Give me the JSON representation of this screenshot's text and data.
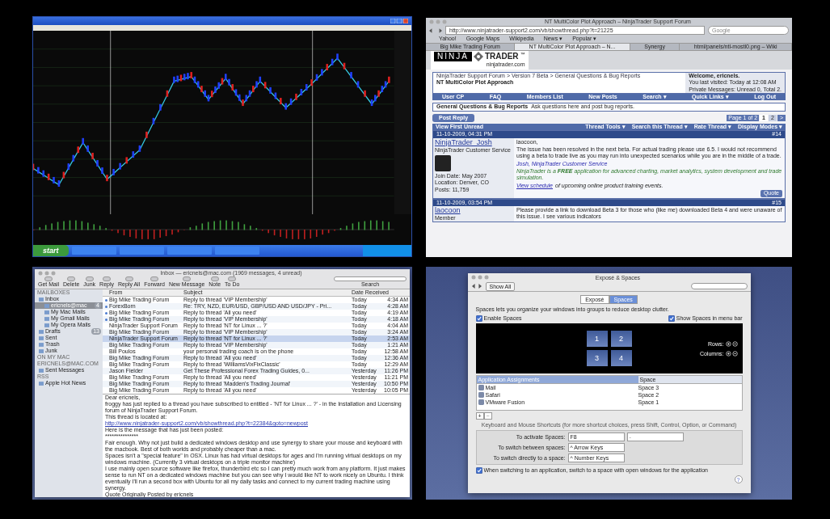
{
  "trading_space": {
    "taskbar": {
      "start": "start"
    }
  },
  "browser_space": {
    "title": "NT MultiColor Plot Approach – NinjaTrader Support Forum",
    "url": "http://www.ninjatrader-support2.com/vb/showthread.php?t=21225",
    "search_placeholder": "Google",
    "bookmarks": [
      "Yahoo!",
      "Google Maps",
      "Wikipedia",
      "News ▾",
      "Popular ▾"
    ],
    "tabs": [
      {
        "label": "Big Mike Trading Forum",
        "selected": false
      },
      {
        "label": "NT MultiColor Plot Approach – N...",
        "selected": true
      },
      {
        "label": "Synergy",
        "selected": false
      },
      {
        "label": "html/panels/ntl-mostl0.png – Wiki",
        "selected": false
      }
    ],
    "logo": {
      "left": "NINJA",
      "right": "TRADER",
      "tm": "™",
      "site": "ninjatrader.com"
    },
    "breadcrumb": "NinjaTrader Support Forum > Version 7 Beta > General Questions & Bug Reports",
    "thread_title": "NT MultiColor Plot Approach",
    "welcome": "Welcome, ericnels.",
    "last_visit": "You last visited: Today at 12:08 AM",
    "private_messages": "Private Messages: Unread 0, Total 2.",
    "nav": [
      "User CP",
      "FAQ",
      "Members List",
      "New Posts",
      "Search ▾",
      "Quick Links ▾",
      "Log Out"
    ],
    "forum_name": "General Questions & Bug Reports",
    "forum_desc": "Ask questions here and post bug reports.",
    "post_reply": "Post Reply",
    "pager": {
      "label": "Page 1 of 2",
      "pages": [
        {
          "label": "1",
          "selected": true
        },
        {
          "label": "2",
          "selected": false
        }
      ],
      "next": ">"
    },
    "first_unread": "View First Unread",
    "thread_tools": [
      "Thread Tools ▾",
      "Search this Thread ▾",
      "Rate Thread ▾",
      "Display Modes ▾"
    ],
    "posts": [
      {
        "date": "11-10-2009, 04:31 PM",
        "number": "#14",
        "author": "NinjaTrader_Josh",
        "role": "NinjaTrader Customer Service",
        "details": [
          "Join Date: May 2007",
          "Location: Denver, CO",
          "Posts: 11,759"
        ],
        "quote": "Quote",
        "body": [
          {
            "kind": "text",
            "text": "laocoon,"
          },
          {
            "kind": "text",
            "text": "The issue has been resolved in the next beta. For actual trading please use 6.5. I would not recommend using a beta to trade live as you may run into unexpected scenarios while you are in the middle of a trade."
          },
          {
            "kind": "signature",
            "text": "Josh, NinjaTrader Customer Service"
          },
          {
            "kind": "promo",
            "text": "NinjaTrader is a **FREE** application for advanced charting, market analytics, system development and trade simulation."
          },
          {
            "kind": "schedule",
            "link": "View schedule",
            "text": "of upcoming online product training events."
          }
        ]
      },
      {
        "date": "11-10-2009, 03:54 PM",
        "number": "#15",
        "author": "laocoon",
        "role": "Member",
        "body": [
          {
            "kind": "text",
            "text": "Please provide a link to download Beta 3 for those who (like me) downloaded Beta 4 and were unaware of this issue. I see various indicators"
          }
        ]
      }
    ]
  },
  "mail_space": {
    "title": "Inbox — ericnels@mac.com (1969 messages, 4 unread)",
    "toolbar": [
      "Get Mail",
      "Delete",
      "Junk",
      "Reply",
      "Reply All",
      "Forward",
      "New Message",
      "Note",
      "To Do"
    ],
    "search_label": "Search",
    "sidebar": [
      {
        "kind": "header",
        "label": "MAILBOXES"
      },
      {
        "kind": "mailbox",
        "label": "Inbox",
        "selected": false,
        "children": [
          {
            "kind": "mailbox",
            "label": "ericnels@mac",
            "selected": true,
            "badge": "4"
          },
          {
            "kind": "mailbox",
            "label": "My Mac Mails",
            "selected": false
          },
          {
            "kind": "mailbox",
            "label": "My Gmail Mails",
            "selected": false
          },
          {
            "kind": "mailbox",
            "label": "My Opera Mails",
            "selected": false
          }
        ]
      },
      {
        "kind": "mailbox",
        "label": "Drafts",
        "selected": false,
        "badge": "13"
      },
      {
        "kind": "mailbox",
        "label": "Sent",
        "selected": false
      },
      {
        "kind": "mailbox",
        "label": "Trash",
        "selected": false
      },
      {
        "kind": "mailbox",
        "label": "Junk",
        "selected": false
      },
      {
        "kind": "header",
        "label": "ON MY MAC"
      },
      {
        "kind": "header",
        "label": "ERICNELS@MAC.COM"
      },
      {
        "kind": "mailbox",
        "label": "Sent Messages",
        "selected": false
      },
      {
        "kind": "header",
        "label": "RSS"
      },
      {
        "kind": "mailbox",
        "label": "Apple Hot News",
        "selected": false
      }
    ],
    "columns": [
      "From",
      "Subject",
      "Date Received"
    ],
    "messages": [
      {
        "from": "Big Mike Trading Forum",
        "subject": "Reply to thread 'VIP Membership'",
        "day": "Today",
        "time": "4:34 AM",
        "unread": true,
        "selected": false
      },
      {
        "from": "ForexBorn",
        "subject": "Re: TRY, NZD, EUR/USD, GBP/USD AND USD/JPY - Pri...",
        "day": "Today",
        "time": "4:28 AM",
        "unread": true,
        "selected": false
      },
      {
        "from": "Big Mike Trading Forum",
        "subject": "Reply to thread 'All you need'",
        "day": "Today",
        "time": "4:19 AM",
        "unread": true,
        "selected": false
      },
      {
        "from": "Big Mike Trading Forum",
        "subject": "Reply to thread 'VIP Membership'",
        "day": "Today",
        "time": "4:18 AM",
        "unread": true,
        "selected": false
      },
      {
        "from": "NinjaTrader Support Forum",
        "subject": "Reply to thread 'NT for Linux ... ?'",
        "day": "Today",
        "time": "4:04 AM",
        "unread": false,
        "selected": false
      },
      {
        "from": "Big Mike Trading Forum",
        "subject": "Reply to thread 'VIP Membership'",
        "day": "Today",
        "time": "3:24 AM",
        "unread": false,
        "selected": false
      },
      {
        "from": "NinjaTrader Support Forum",
        "subject": "Reply to thread 'NT for Linux ... ?'",
        "day": "Today",
        "time": "2:53 AM",
        "unread": false,
        "selected": true
      },
      {
        "from": "Big Mike Trading Forum",
        "subject": "Reply to thread 'VIP Membership'",
        "day": "Today",
        "time": "1:21 AM",
        "unread": false,
        "selected": false
      },
      {
        "from": "Bill Poulos",
        "subject": "your personal trading coach is on the phone",
        "day": "Today",
        "time": "12:58 AM",
        "unread": false,
        "selected": false
      },
      {
        "from": "Big Mike Trading Forum",
        "subject": "Reply to thread 'All you need'",
        "day": "Today",
        "time": "12:36 AM",
        "unread": false,
        "selected": false
      },
      {
        "from": "Big Mike Trading Forum",
        "subject": "Reply to thread 'WilliamsVixFixClassic'",
        "day": "Today",
        "time": "12:29 AM",
        "unread": false,
        "selected": false
      },
      {
        "from": "Jason Fielder",
        "subject": "Get These Professional Forex Trading Guides, 0...",
        "day": "Yesterday",
        "time": "11:26 PM",
        "unread": false,
        "selected": false
      },
      {
        "from": "Big Mike Trading Forum",
        "subject": "Reply to thread 'All you need'",
        "day": "Yesterday",
        "time": "11:21 PM",
        "unread": false,
        "selected": false
      },
      {
        "from": "Big Mike Trading Forum",
        "subject": "Reply to thread 'Madden's Trading Journal'",
        "day": "Yesterday",
        "time": "10:50 PM",
        "unread": false,
        "selected": false
      },
      {
        "from": "Big Mike Trading Forum",
        "subject": "Reply to thread 'All you need'",
        "day": "Yesterday",
        "time": "10:05 PM",
        "unread": false,
        "selected": false
      }
    ],
    "body": [
      {
        "kind": "text",
        "text": "Dear ericnels,"
      },
      {
        "kind": "text",
        "text": "froggy has just replied to a thread you have subscribed to entitled - 'NT for Linux ... ?' - in the Installation and Licensing forum of NinjaTrader Support Forum."
      },
      {
        "kind": "text",
        "text": "This thread is located at:"
      },
      {
        "kind": "link",
        "text": "http://www.ninjatrader-support2.com/vb/showthread.php?t=22384&goto=newpost"
      },
      {
        "kind": "text",
        "text": "Here is the message that has just been posted:"
      },
      {
        "kind": "text",
        "text": "***************"
      },
      {
        "kind": "text",
        "text": "Fair enough. Why not just build a dedicated windows desktop and use synergy to share your mouse and keyboard with the macbook. Best of both worlds and probably cheaper than a mac."
      },
      {
        "kind": "text",
        "text": "Spaces isn't a \"special feature\" in OSX. Linux has had virtual desktops for ages and I'm running virtual desktops on my windows machine. (Currently 3 virtual desktops on a triple monitor machine)"
      },
      {
        "kind": "text",
        "text": "I use mainly open source software like firefox, thunderbird etc so I can pretty much work from any platform. It just makes sense to run NT on a dedicated windows machine but you can see why I would like NT to work nicely on Ubuntu. I think eventually I'll run a second box with Ubuntu for all my daily tasks and connect to my current trading machine using synergy."
      },
      {
        "kind": "text",
        "text": "Quote Originally Posted by ericnels"
      }
    ]
  },
  "preferences_space": {
    "title": "Exposé & Spaces",
    "show_all": "Show All",
    "tabs": [
      {
        "label": "Exposé",
        "selected": false
      },
      {
        "label": "Spaces",
        "selected": true
      }
    ],
    "intro": "Spaces lets you organize your windows into groups to reduce desktop clutter.",
    "enable": {
      "label": "Enable Spaces",
      "checked": true
    },
    "menu_bar": {
      "label": "Show Spaces in menu bar",
      "checked": true
    },
    "spaces": [
      "1",
      "2",
      "3",
      "4"
    ],
    "rows_label": "Rows:",
    "columns_label": "Columns:",
    "assign_columns": [
      "Application Assignments",
      "Space"
    ],
    "assignments": [
      {
        "app": "Mail",
        "space": "Space 3"
      },
      {
        "app": "Safari",
        "space": "Space 2"
      },
      {
        "app": "VMware Fusion",
        "space": "Space 1"
      }
    ],
    "add": "+",
    "remove": "−",
    "shortcuts_note": "Keyboard and Mouse Shortcuts (for more shortcut choices, press Shift, Control, Option, or Command)",
    "shortcuts": [
      {
        "label": "To activate Spaces:",
        "value": "F8",
        "extra": "-"
      },
      {
        "label": "To switch between spaces:",
        "value": "^ Arrow Keys"
      },
      {
        "label": "To switch directly to a space:",
        "value": "^ Number Keys"
      }
    ],
    "follow": {
      "label": "When switching to an application, switch to a space with open windows for the application",
      "checked": true
    },
    "help": "?"
  }
}
